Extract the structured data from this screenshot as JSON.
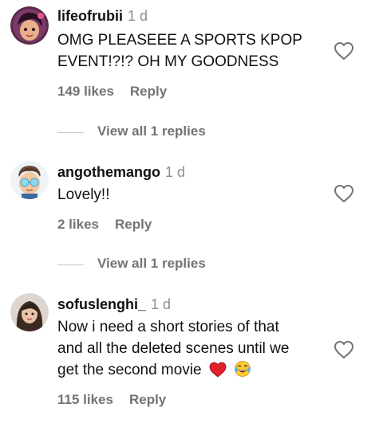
{
  "comments": [
    {
      "username": "lifeofrubii",
      "time": "1 d",
      "text_lines": [
        "OMG PLEASEEE A SPORTS KPOP",
        "EVENT!?!? OH MY GOODNESS"
      ],
      "likes": "149 likes",
      "reply": "Reply",
      "view_replies": "View all 1 replies"
    },
    {
      "username": "angothemango",
      "time": "1 d",
      "text_lines": [
        "Lovely!!"
      ],
      "likes": "2 likes",
      "reply": "Reply",
      "view_replies": "View all 1 replies"
    },
    {
      "username": "sofuslenghi_",
      "time": "1 d",
      "text_lines": [
        "Now i need a short stories of that",
        "and all the deleted scenes until we",
        "get the second movie"
      ],
      "likes": "115 likes",
      "reply": "Reply"
    }
  ],
  "icons": {
    "like": "heart-outline-icon",
    "emoji_1": "red-heart-emoji",
    "emoji_2": "tears-of-joy-emoji"
  },
  "colors": {
    "heart_emoji": "#e0202a",
    "secondary_text": "#737373",
    "divider": "#c7c7c7"
  }
}
